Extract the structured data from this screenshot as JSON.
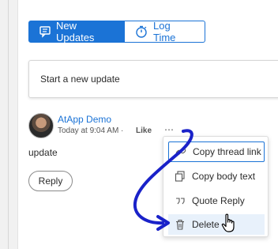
{
  "tabs": {
    "new_updates": "New Updates",
    "log_time": "Log Time"
  },
  "composer": {
    "placeholder": "Start a new update"
  },
  "post": {
    "author": "AtApp Demo",
    "timestamp": "Today at 9:04 AM ·",
    "like": "Like",
    "more": "⋯",
    "body": "update",
    "reply": "Reply"
  },
  "menu": {
    "items": [
      {
        "label": "Copy thread link",
        "icon": "link-icon"
      },
      {
        "label": "Copy body text",
        "icon": "copy-icon"
      },
      {
        "label": "Quote Reply",
        "icon": "quote-icon"
      },
      {
        "label": "Delete",
        "icon": "trash-icon"
      }
    ]
  },
  "colors": {
    "accent": "#1b73d6",
    "annotation_arrow": "#1a22c9"
  }
}
